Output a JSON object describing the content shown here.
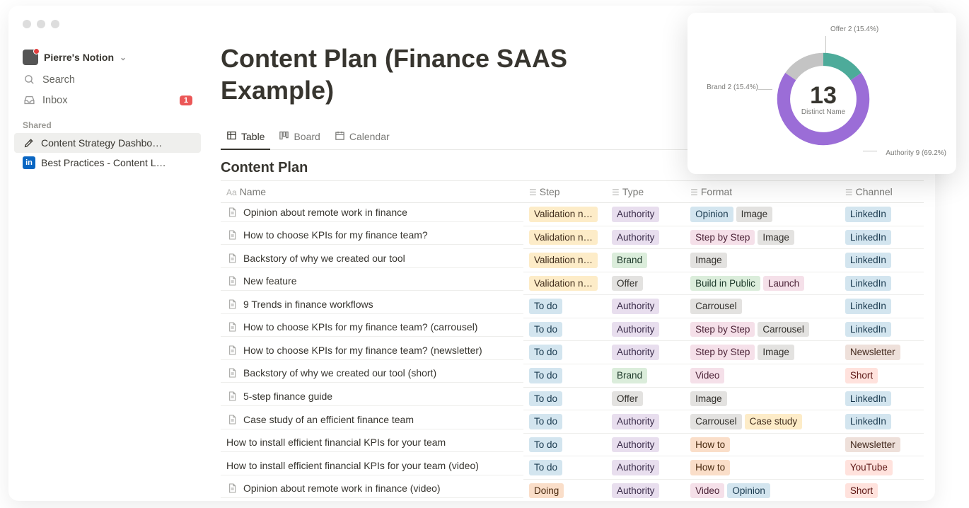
{
  "workspace": {
    "owner": "Pierre's Notion",
    "search_label": "Search",
    "inbox_label": "Inbox",
    "inbox_badge": "1",
    "section_shared": "Shared",
    "pages": [
      {
        "icon": "pen",
        "title": "Content Strategy Dashbo…",
        "active": true
      },
      {
        "icon": "linkedin",
        "title": "Best Practices - Content L…",
        "active": false
      }
    ]
  },
  "page": {
    "title": "Content Plan (Finance SAAS Example)",
    "tabs": [
      {
        "icon": "table",
        "label": "Table",
        "active": true
      },
      {
        "icon": "board",
        "label": "Board",
        "active": false
      },
      {
        "icon": "calendar",
        "label": "Calendar",
        "active": false
      }
    ],
    "database_title": "Content Plan",
    "columns": {
      "name": "Name",
      "step": "Step",
      "type": "Type",
      "format": "Format",
      "channel": "Channel"
    }
  },
  "tag_colors": {
    "Validation n…": "t-yellow",
    "To do": "t-blue",
    "Doing": "t-orange",
    "Authority": "t-purple",
    "Brand": "t-green",
    "Offer": "t-gray",
    "Opinion": "t-blue",
    "Image": "t-gray",
    "Step by Step": "t-pink",
    "Build in Public": "t-green",
    "Launch": "t-pink",
    "Carrousel": "t-gray",
    "Video": "t-pink",
    "Case study": "t-yellow",
    "How to": "t-orange",
    "LinkedIn": "t-blue",
    "Newsletter": "t-brown",
    "Short": "t-red",
    "YouTube": "t-red"
  },
  "rows": [
    {
      "icon": true,
      "name": "Opinion about remote work in finance",
      "step": "Validation n…",
      "type": "Authority",
      "format": [
        "Opinion",
        "Image"
      ],
      "channel": "LinkedIn"
    },
    {
      "icon": true,
      "name": "How to choose KPIs for my finance team?",
      "step": "Validation n…",
      "type": "Authority",
      "format": [
        "Step by Step",
        "Image"
      ],
      "channel": "LinkedIn"
    },
    {
      "icon": true,
      "name": "Backstory of why we created our tool",
      "step": "Validation n…",
      "type": "Brand",
      "format": [
        "Image"
      ],
      "channel": "LinkedIn"
    },
    {
      "icon": true,
      "name": "New feature",
      "step": "Validation n…",
      "type": "Offer",
      "format": [
        "Build in Public",
        "Launch"
      ],
      "channel": "LinkedIn"
    },
    {
      "icon": true,
      "name": "9 Trends in finance workflows",
      "step": "To do",
      "type": "Authority",
      "format": [
        "Carrousel"
      ],
      "channel": "LinkedIn"
    },
    {
      "icon": true,
      "name": "How to choose KPIs for my finance team? (carrousel)",
      "step": "To do",
      "type": "Authority",
      "format": [
        "Step by Step",
        "Carrousel"
      ],
      "channel": "LinkedIn"
    },
    {
      "icon": true,
      "name": "How to choose KPIs for my finance team? (newsletter)",
      "step": "To do",
      "type": "Authority",
      "format": [
        "Step by Step",
        "Image"
      ],
      "channel": "Newsletter"
    },
    {
      "icon": true,
      "name": "Backstory of why we created our tool (short)",
      "step": "To do",
      "type": "Brand",
      "format": [
        "Video"
      ],
      "channel": "Short"
    },
    {
      "icon": true,
      "name": "5-step finance guide",
      "step": "To do",
      "type": "Offer",
      "format": [
        "Image"
      ],
      "channel": "LinkedIn"
    },
    {
      "icon": true,
      "name": "Case study of an efficient finance team",
      "step": "To do",
      "type": "Authority",
      "format": [
        "Carrousel",
        "Case study"
      ],
      "channel": "LinkedIn"
    },
    {
      "icon": false,
      "name": "How to install efficient financial KPIs for your team",
      "step": "To do",
      "type": "Authority",
      "format": [
        "How to"
      ],
      "channel": "Newsletter"
    },
    {
      "icon": false,
      "name": "How to install efficient financial KPIs for your team (video)",
      "step": "To do",
      "type": "Authority",
      "format": [
        "How to"
      ],
      "channel": "YouTube"
    },
    {
      "icon": true,
      "name": "Opinion about remote work in finance (video)",
      "step": "Doing",
      "type": "Authority",
      "format": [
        "Video",
        "Opinion"
      ],
      "channel": "Short"
    }
  ],
  "chart_data": {
    "type": "pie",
    "title": "",
    "center_value": 13,
    "center_label": "Distinct Name",
    "series": [
      {
        "name": "Authority",
        "value": 9,
        "pct": 69.2,
        "color": "#9b6dd7"
      },
      {
        "name": "Brand",
        "value": 2,
        "pct": 15.4,
        "color": "#4dab9a"
      },
      {
        "name": "Offer",
        "value": 2,
        "pct": 15.4,
        "color": "#c4c4c4"
      }
    ],
    "labels_visible": [
      "Offer 2 (15.4%)",
      "Brand 2 (15.4%)",
      "Authority 9 (69.2%)"
    ]
  }
}
